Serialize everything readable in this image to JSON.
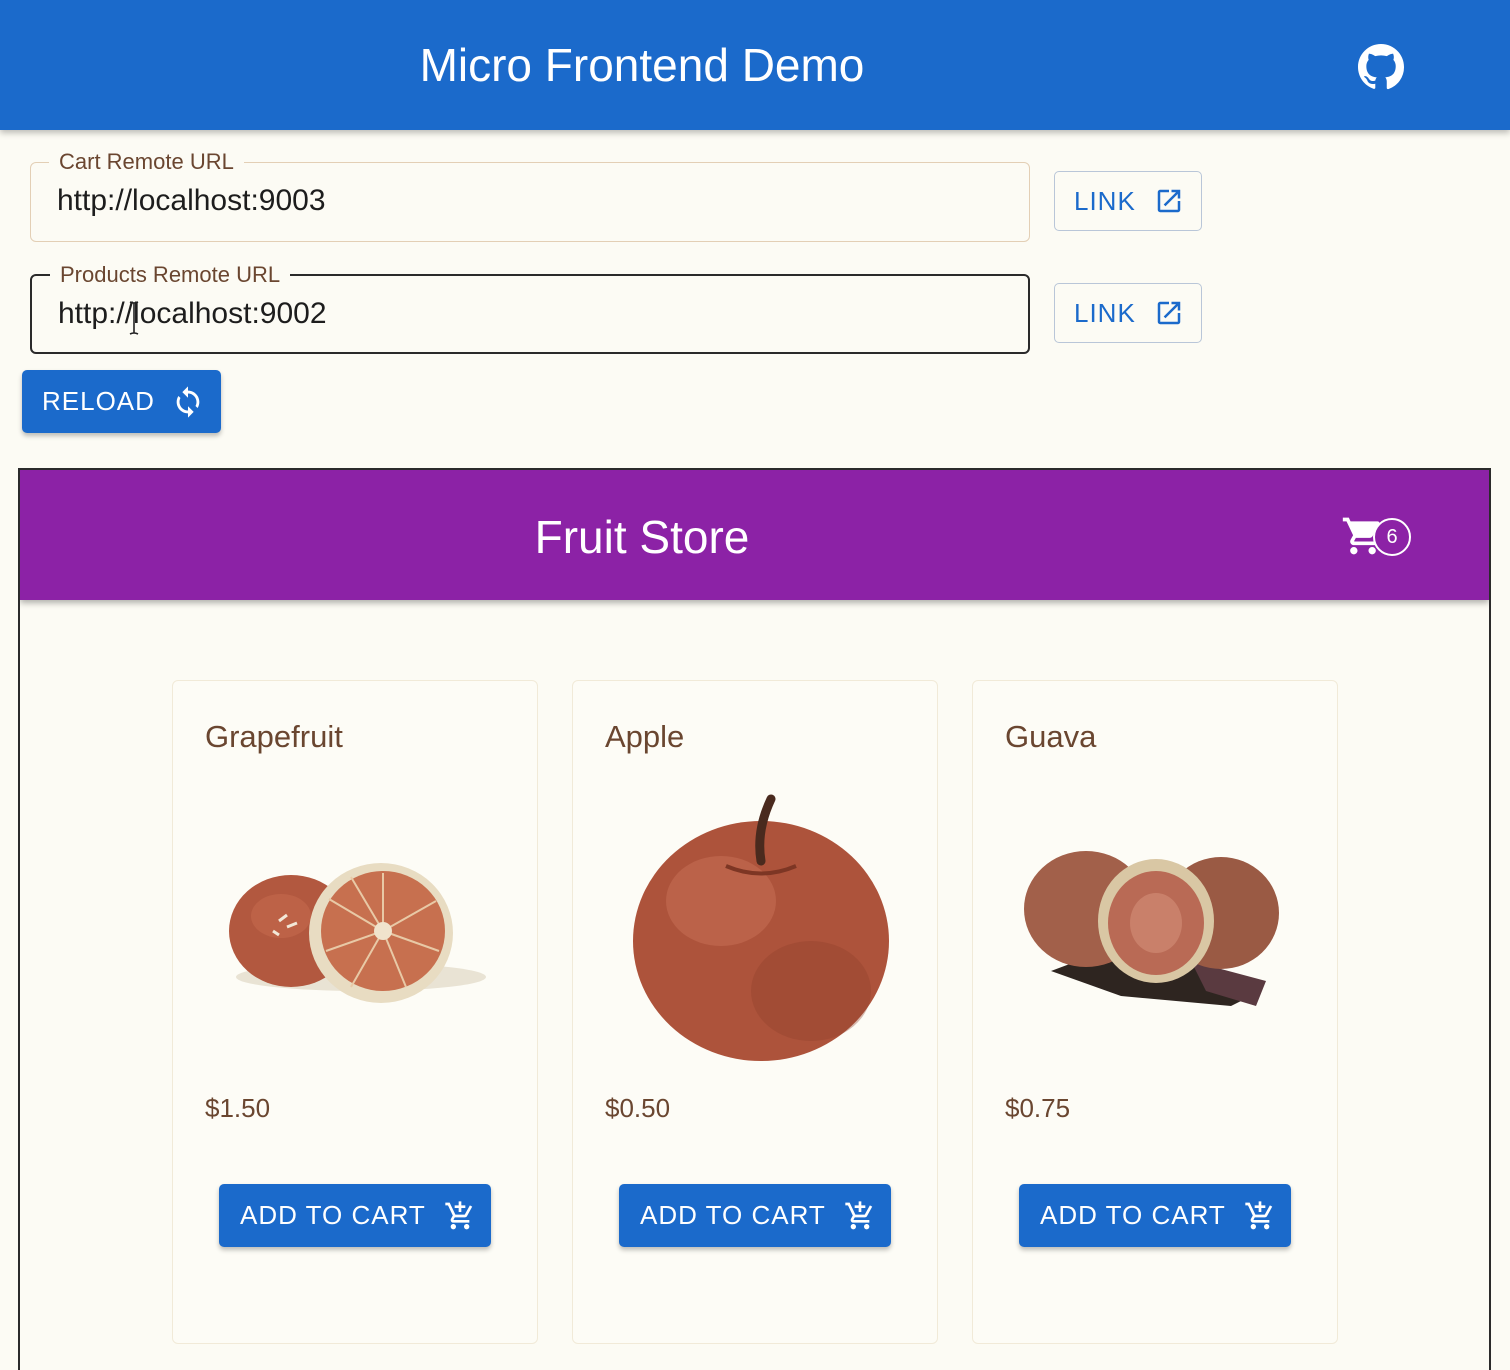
{
  "header": {
    "title": "Micro Frontend Demo",
    "github_icon": "github-icon"
  },
  "cart_remote": {
    "label": "Cart Remote URL",
    "value": "http://localhost:9003",
    "link_label": "LINK"
  },
  "products_remote": {
    "label": "Products Remote URL",
    "value": "http://localhost:9002",
    "link_label": "LINK"
  },
  "reload": {
    "label": "RELOAD"
  },
  "store": {
    "title": "Fruit Store",
    "cart_count": "6",
    "products": [
      {
        "name": "Grapefruit",
        "price": "$1.50",
        "button": "ADD TO CART"
      },
      {
        "name": "Apple",
        "price": "$0.50",
        "button": "ADD TO CART"
      },
      {
        "name": "Guava",
        "price": "$0.75",
        "button": "ADD TO CART"
      }
    ]
  },
  "colors": {
    "primary": "#1b6acb",
    "store_bar": "#8c22a6",
    "text_brown": "#6a4630"
  }
}
